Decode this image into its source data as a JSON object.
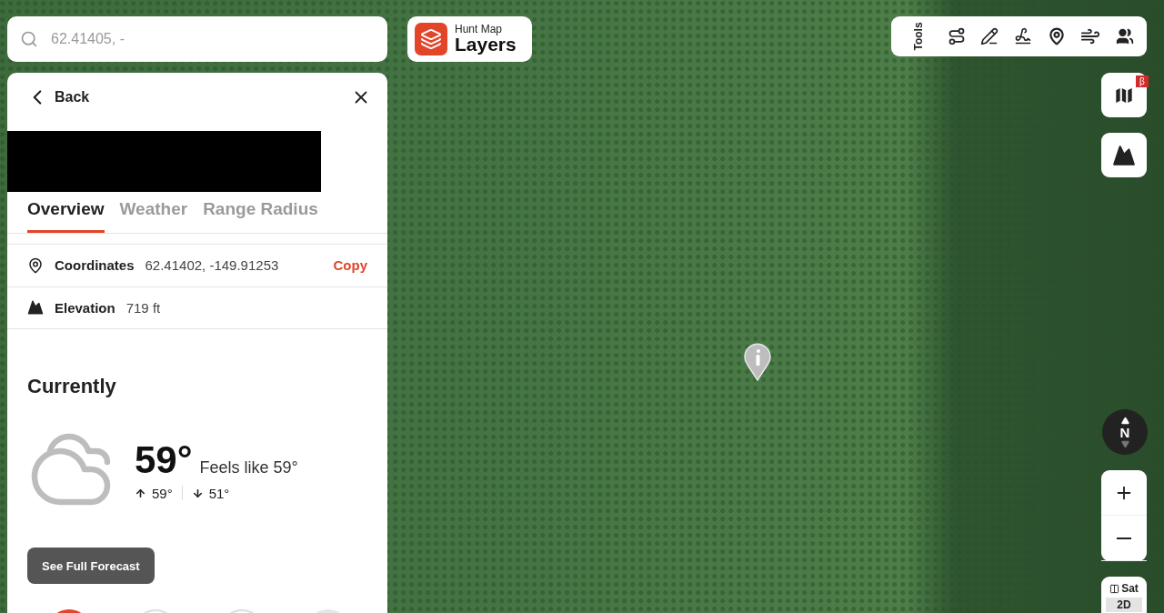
{
  "search": {
    "placeholder": "62.41405, -"
  },
  "layers_button": {
    "caption": "Hunt Map",
    "label": "Layers"
  },
  "toolbar": {
    "label": "Tools"
  },
  "panel": {
    "back": "Back",
    "tabs": [
      {
        "label": "Overview",
        "selected": true
      },
      {
        "label": "Weather",
        "selected": false
      },
      {
        "label": "Range Radius",
        "selected": false
      }
    ],
    "details": [
      {
        "kind": "coordinates",
        "label": "Coordinates",
        "value": "62.41402, -149.91253",
        "action": "Copy"
      },
      {
        "kind": "elevation",
        "label": "Elevation",
        "value": "719 ft"
      }
    ],
    "weather": {
      "heading": "Currently",
      "temperature": "59°",
      "feels_like": "Feels like 59°",
      "high": "59°",
      "low": "51°",
      "button": "See Full Forecast"
    },
    "action_buttons": [
      {
        "kind": "primary"
      },
      {
        "kind": "outline"
      },
      {
        "kind": "outline"
      },
      {
        "kind": "muted"
      }
    ]
  },
  "map_controls": {
    "beta_badge": "β",
    "compass": "N",
    "view_mode": "Sat",
    "dimension": "2D"
  }
}
